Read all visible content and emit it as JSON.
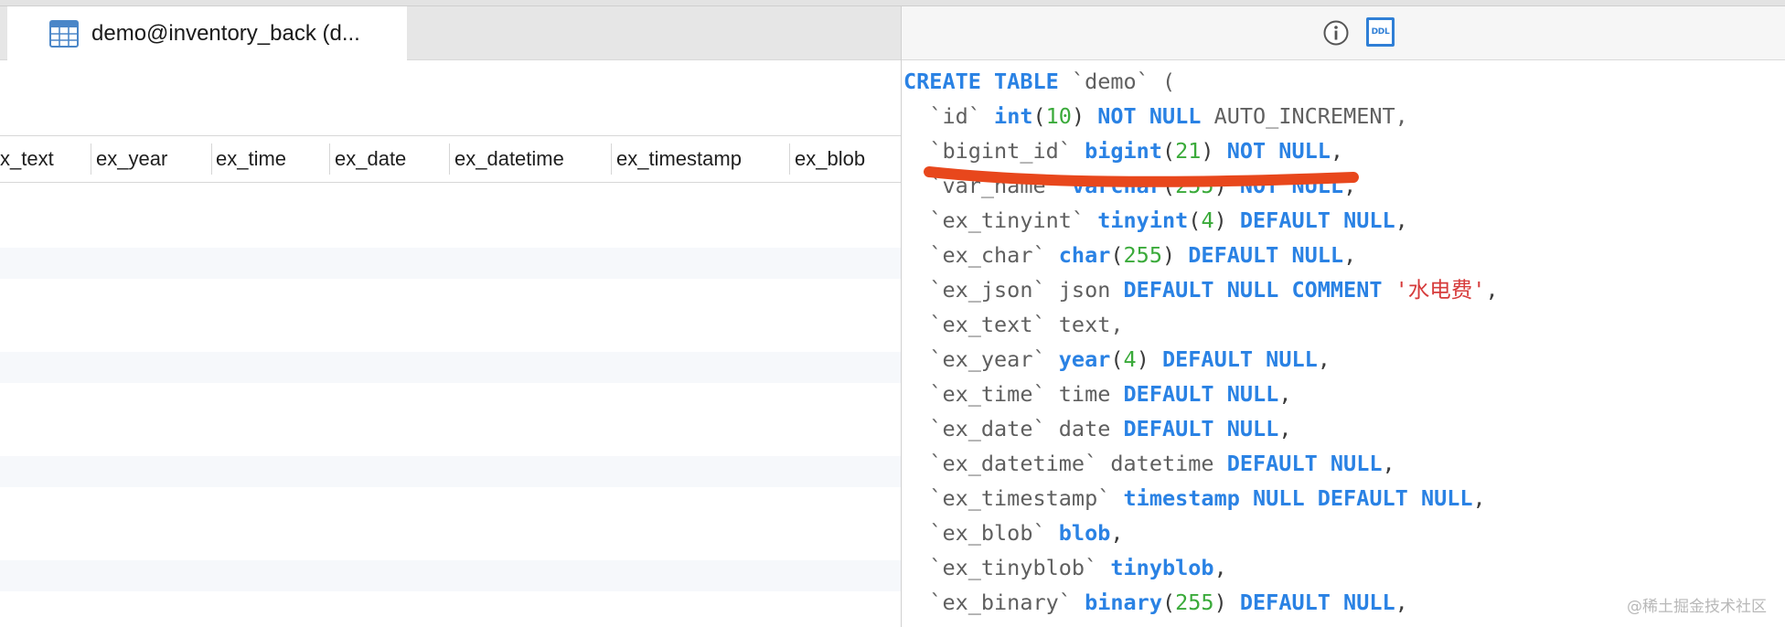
{
  "tab": {
    "title": "demo@inventory_back (d...",
    "icon": "table-grid-icon"
  },
  "grid": {
    "columns": [
      "x_text",
      "ex_year",
      "ex_time",
      "ex_date",
      "ex_datetime",
      "ex_timestamp",
      "ex_blob"
    ]
  },
  "toolbar": {
    "info_icon": "info-icon",
    "ddl_label": "DDL"
  },
  "ddl": {
    "lines": [
      [
        {
          "t": "CREATE TABLE",
          "c": "kw"
        },
        {
          "t": " `demo` (",
          "c": "gray"
        }
      ],
      [
        {
          "t": "  `id` ",
          "c": "gray"
        },
        {
          "t": "int",
          "c": "kw"
        },
        {
          "t": "(",
          "c": "plain"
        },
        {
          "t": "10",
          "c": "num"
        },
        {
          "t": ") ",
          "c": "plain"
        },
        {
          "t": "NOT NULL",
          "c": "kw"
        },
        {
          "t": " AUTO_INCREMENT,",
          "c": "gray"
        }
      ],
      [
        {
          "t": "  `bigint_id` ",
          "c": "gray"
        },
        {
          "t": "bigint",
          "c": "kw"
        },
        {
          "t": "(",
          "c": "plain"
        },
        {
          "t": "21",
          "c": "num"
        },
        {
          "t": ") ",
          "c": "plain"
        },
        {
          "t": "NOT NULL",
          "c": "kw"
        },
        {
          "t": ",",
          "c": "plain"
        }
      ],
      [
        {
          "t": "  `var_name` ",
          "c": "gray"
        },
        {
          "t": "varchar",
          "c": "kw"
        },
        {
          "t": "(",
          "c": "plain"
        },
        {
          "t": "255",
          "c": "num"
        },
        {
          "t": ") ",
          "c": "plain"
        },
        {
          "t": "NOT NULL",
          "c": "kw"
        },
        {
          "t": ",",
          "c": "plain"
        }
      ],
      [
        {
          "t": "  `ex_tinyint` ",
          "c": "gray"
        },
        {
          "t": "tinyint",
          "c": "kw"
        },
        {
          "t": "(",
          "c": "plain"
        },
        {
          "t": "4",
          "c": "num"
        },
        {
          "t": ") ",
          "c": "plain"
        },
        {
          "t": "DEFAULT NULL",
          "c": "kw"
        },
        {
          "t": ",",
          "c": "plain"
        }
      ],
      [
        {
          "t": "  `ex_char` ",
          "c": "gray"
        },
        {
          "t": "char",
          "c": "kw"
        },
        {
          "t": "(",
          "c": "plain"
        },
        {
          "t": "255",
          "c": "num"
        },
        {
          "t": ") ",
          "c": "plain"
        },
        {
          "t": "DEFAULT NULL",
          "c": "kw"
        },
        {
          "t": ",",
          "c": "plain"
        }
      ],
      [
        {
          "t": "  `ex_json` json ",
          "c": "gray"
        },
        {
          "t": "DEFAULT NULL COMMENT",
          "c": "kw"
        },
        {
          "t": " ",
          "c": "plain"
        },
        {
          "t": "'水电费'",
          "c": "str"
        },
        {
          "t": ",",
          "c": "plain"
        }
      ],
      [
        {
          "t": "  `ex_text` text,",
          "c": "gray"
        }
      ],
      [
        {
          "t": "  `ex_year` ",
          "c": "gray"
        },
        {
          "t": "year",
          "c": "kw"
        },
        {
          "t": "(",
          "c": "plain"
        },
        {
          "t": "4",
          "c": "num"
        },
        {
          "t": ") ",
          "c": "plain"
        },
        {
          "t": "DEFAULT NULL",
          "c": "kw"
        },
        {
          "t": ",",
          "c": "plain"
        }
      ],
      [
        {
          "t": "  `ex_time` time ",
          "c": "gray"
        },
        {
          "t": "DEFAULT NULL",
          "c": "kw"
        },
        {
          "t": ",",
          "c": "plain"
        }
      ],
      [
        {
          "t": "  `ex_date` date ",
          "c": "gray"
        },
        {
          "t": "DEFAULT NULL",
          "c": "kw"
        },
        {
          "t": ",",
          "c": "plain"
        }
      ],
      [
        {
          "t": "  `ex_datetime` datetime ",
          "c": "gray"
        },
        {
          "t": "DEFAULT NULL",
          "c": "kw"
        },
        {
          "t": ",",
          "c": "plain"
        }
      ],
      [
        {
          "t": "  `ex_timestamp` ",
          "c": "gray"
        },
        {
          "t": "timestamp NULL DEFAULT NULL",
          "c": "kw"
        },
        {
          "t": ",",
          "c": "plain"
        }
      ],
      [
        {
          "t": "  `ex_blob` ",
          "c": "gray"
        },
        {
          "t": "blob",
          "c": "kw"
        },
        {
          "t": ",",
          "c": "plain"
        }
      ],
      [
        {
          "t": "  `ex_tinyblob` ",
          "c": "gray"
        },
        {
          "t": "tinyblob",
          "c": "kw"
        },
        {
          "t": ",",
          "c": "plain"
        }
      ],
      [
        {
          "t": "  `ex_binary` ",
          "c": "gray"
        },
        {
          "t": "binary",
          "c": "kw"
        },
        {
          "t": "(",
          "c": "plain"
        },
        {
          "t": "255",
          "c": "num"
        },
        {
          "t": ") ",
          "c": "plain"
        },
        {
          "t": "DEFAULT NULL",
          "c": "kw"
        },
        {
          "t": ",",
          "c": "plain"
        }
      ]
    ]
  },
  "colors": {
    "keyword": "#2a82e4",
    "number": "#3aaa3a",
    "string": "#d63b3b",
    "annotation": "#e8471c",
    "accent": "#2f7fd6"
  },
  "watermark": "@稀土掘金技术社区"
}
